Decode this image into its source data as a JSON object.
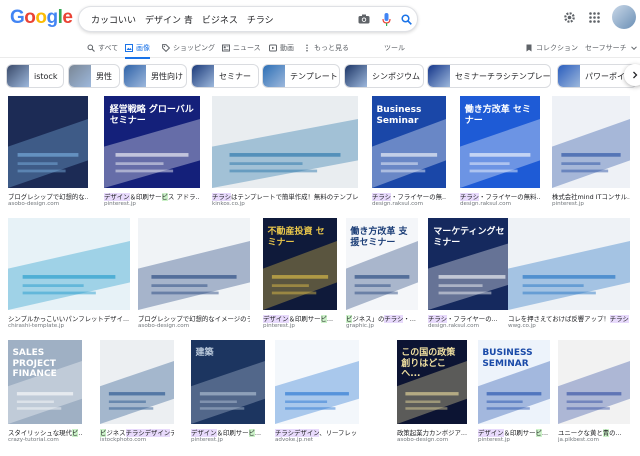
{
  "logo": {
    "letters": [
      {
        "c": "G",
        "color": "#4285F4"
      },
      {
        "c": "o",
        "color": "#EA4335"
      },
      {
        "c": "o",
        "color": "#FBBC05"
      },
      {
        "c": "g",
        "color": "#4285F4"
      },
      {
        "c": "l",
        "color": "#34A853"
      },
      {
        "c": "e",
        "color": "#EA4335"
      }
    ]
  },
  "search": {
    "query": "カッコいい　デザイン 青　ビジネス　チラシ"
  },
  "tabs": {
    "all": "すべて",
    "images": "画像",
    "shopping": "ショッピング",
    "news": "ニュース",
    "videos": "動画",
    "more": "もっと見る",
    "tools": "ツール",
    "collections": "コレクション",
    "safesearch": "セーフサーチ"
  },
  "chips": [
    "istock",
    "男性",
    "男性向け",
    "セミナー",
    "テンプレート",
    "シンポジウム",
    "セミナーチラシテンプレート",
    "パワーポイ"
  ],
  "results": [
    {
      "cap": "ブログレシップで幻想的な...",
      "src": "asobo-design.com",
      "bg": "#1c2b55",
      "fg": "#7fb5e6",
      "title": ""
    },
    {
      "cap": "デザイン＆印刷サービス アドラ...",
      "src": "pinterest.jp",
      "bg": "#14207a",
      "fg": "#ffffff",
      "title": "経営戦略 グローバル セミナー"
    },
    {
      "cap": "チラシはテンプレートで簡単作成！無料のテンプレ...",
      "src": "kinkos.co.jp",
      "bg": "#e9edf0",
      "fg": "#1f6fa6",
      "title": ""
    },
    {
      "cap": "チラシ・フライヤーの無...",
      "src": "design.raksul.com",
      "bg": "#1a47a8",
      "fg": "#ffffff",
      "title": "Business Seminar"
    },
    {
      "cap": "チラシ・フライヤーの無料...",
      "src": "design.raksul.com",
      "bg": "#1e5bd6",
      "fg": "#ffffff",
      "title": "働き方改革 セミナー"
    },
    {
      "cap": "株式会社mind ITコンサル...",
      "src": "pinterest.jp",
      "bg": "#eef1f6",
      "fg": "#1f4aa0",
      "title": ""
    },
    {
      "cap": "シンプルかっこいいパンフレットデザイ...",
      "src": "chirashi-template.jp",
      "bg": "#e7f2f7",
      "fg": "#1a97c9",
      "title": ""
    },
    {
      "cap": "ブログレシップで幻想的なイメージのラ...",
      "src": "asobo-design.com",
      "bg": "#f0f3f6",
      "fg": "#1c3f7a",
      "title": ""
    },
    {
      "cap": "デザイン＆印刷サービ...",
      "src": "pinterest.jp",
      "bg": "#0f1a3a",
      "fg": "#e8c64a",
      "title": "不動産投資 セミナー"
    },
    {
      "cap": "ビジネス」のチラシ・...",
      "src": "graphic.jp",
      "bg": "#f4f6f9",
      "fg": "#1d3f78",
      "title": "働き方改革 支援セミナー"
    },
    {
      "cap": "チラシ・フライヤーの...",
      "src": "design.raksul.com",
      "bg": "#15295e",
      "fg": "#ffffff",
      "title": "マーケティングセミナー"
    },
    {
      "cap": "コレを押さえておけば反響アップ！チラシ",
      "src": "wwg.co.jp",
      "bg": "#eef2f6",
      "fg": "#1a6ec1",
      "title": ""
    },
    {
      "cap": "スタイリッシュな現代ビ...",
      "src": "crazy-tutorial.com",
      "bg": "#9fb0c4",
      "fg": "#ffffff",
      "title": "SALES PROJECT FINANCE"
    },
    {
      "cap": "ビジネスチラシデザインテ...",
      "src": "istockphoto.com",
      "bg": "#eceff2",
      "fg": "#1f4f8a",
      "title": ""
    },
    {
      "cap": "デザイン＆印刷サービ...",
      "src": "pinterest.jp",
      "bg": "#1c3560",
      "fg": "#b8c7d9",
      "title": "建築"
    },
    {
      "cap": "チラシデザイン、リーフレット制作 | K...",
      "src": "advoke.jp.net",
      "bg": "#f3f7fb",
      "fg": "#1f6fd1",
      "title": ""
    },
    {
      "cap": "政策起業力カンボジア...",
      "src": "asobo-design.com",
      "bg": "#0c1433",
      "fg": "#f0e0a0",
      "title": "この国の政策創りはどこへ..."
    },
    {
      "cap": "デザイン＆印刷サービ...",
      "src": "pinterest.jp",
      "bg": "#edf3fb",
      "fg": "#1a4aa8",
      "title": "BUSINESS SEMINAR"
    },
    {
      "cap": "ユニークな黄と青の...",
      "src": "ja.pikbest.com",
      "bg": "#f2f2f2",
      "fg": "#2d4aa0",
      "title": ""
    }
  ]
}
